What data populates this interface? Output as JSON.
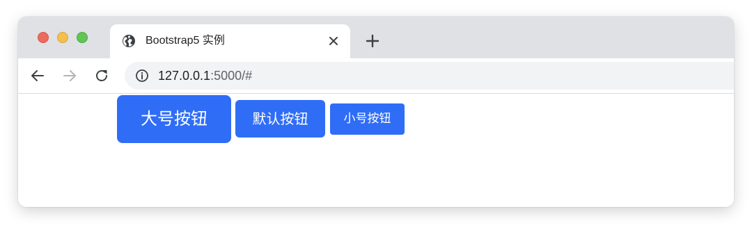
{
  "window": {
    "traffic_lights": {
      "close_color": "#ec6a5e",
      "minimize_color": "#f4bf4f",
      "maximize_color": "#61c554"
    }
  },
  "tab": {
    "icon": "globe-icon",
    "title": "Bootstrap5 实例",
    "close_icon": "close-icon"
  },
  "new_tab_icon": "plus-icon",
  "toolbar": {
    "back_icon": "arrow-left-icon",
    "forward_icon": "arrow-right-icon",
    "reload_icon": "reload-icon",
    "info_icon": "info-icon",
    "url_host": "127.0.0.1",
    "url_rest": ":5000/#"
  },
  "buttons": {
    "large_label": "大号按钮",
    "default_label": "默认按钮",
    "small_label": "小号按钮",
    "color": "#2f6df6"
  }
}
